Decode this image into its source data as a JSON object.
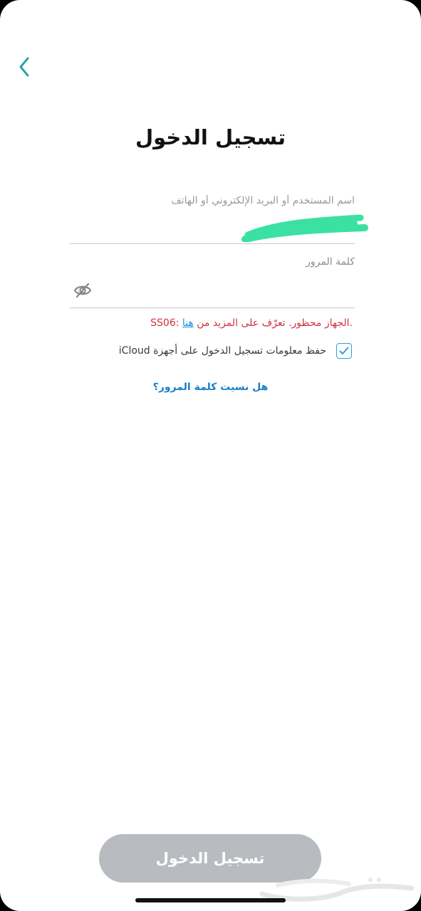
{
  "header": {
    "back_icon": "chevron-left-icon",
    "title": "تسجيل الدخول"
  },
  "form": {
    "username": {
      "placeholder": "اسم المستخدم أو البريد الإلكتروني أو الهاتف",
      "value": ""
    },
    "password": {
      "label": "كلمة المرور",
      "value": "",
      "toggle_icon": "eye-slash-icon"
    },
    "error": {
      "prefix": ".الجهاز محظور. تعرّف على المزيد من ",
      "link_text": "هنا",
      "code": " :SS06"
    },
    "remember": {
      "checked": true,
      "label": "حفظ معلومات تسجيل الدخول على أجهزة iCloud"
    },
    "forgot_password": "هل نسيت كلمة المرور؟"
  },
  "footer": {
    "login_button": "تسجيل الدخول",
    "watermark": "حراج"
  },
  "colors": {
    "accent": "#1a7fc7",
    "error": "#d0323f",
    "button_disabled": "#b8bcc1",
    "back_chevron": "#2fa3b0",
    "redaction": "#3be0a3"
  }
}
